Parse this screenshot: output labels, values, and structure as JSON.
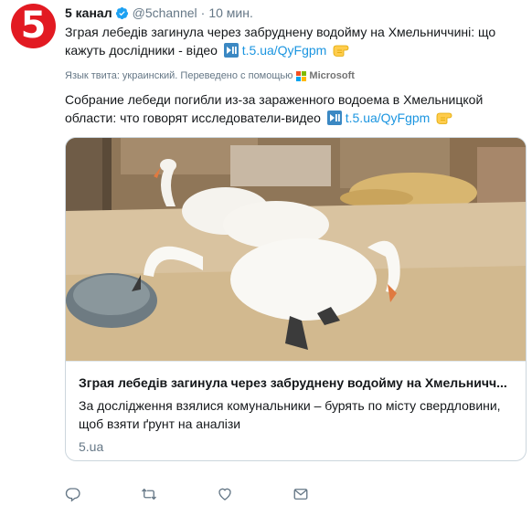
{
  "avatar": {
    "glyph": "5",
    "color": "#e21a22"
  },
  "header": {
    "name": "5 канал",
    "handle": "@5channel",
    "separator": "·",
    "time": "10 мин."
  },
  "tweet": {
    "text": "Зграя лебедів загинула через забруднену водойму на Хмельниччині: що кажуть дослідники - відео",
    "link": "t.5.ua/QyFgpm",
    "play_emoji": "play-pause-icon",
    "pointing_emoji": "pointing-hand-icon"
  },
  "translation": {
    "label": "Язык твита: украинский. Переведено с помощью",
    "provider": "Microsoft",
    "text": "Собрание лебеди погибли из-за зараженного водоема в Хмельницкой области: что говорят исследователи-видео",
    "link": "t.5.ua/QyFgpm"
  },
  "card": {
    "title": "Зграя лебедів загинула через забруднену водойму на Хмельничч...",
    "description": "За дослідження взялися комунальники – бурять по місту свердловини, щоб взяти ґрунт на аналізи",
    "domain": "5.ua"
  },
  "actions": [
    "reply-icon",
    "retweet-icon",
    "like-icon",
    "message-icon"
  ],
  "colors": {
    "link": "#1b95e0",
    "muted": "#657786",
    "border": "#ccd6dd",
    "verified": "#1da1f2"
  }
}
